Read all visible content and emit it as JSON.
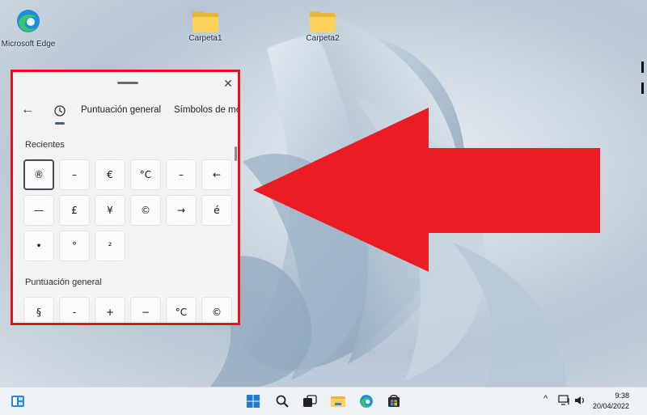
{
  "desktop": {
    "icons": [
      {
        "label": "Microsoft Edge",
        "icon": "edge-icon"
      },
      {
        "label": "Carpeta1",
        "icon": "folder-icon"
      },
      {
        "label": "Carpeta2",
        "icon": "folder-icon"
      }
    ]
  },
  "emoji_panel": {
    "close_glyph": "✕",
    "back_glyph": "←",
    "tabs": [
      "Puntuación general",
      "Símbolos de mo"
    ],
    "sections": {
      "recent_title": "Recientes",
      "punctuation_title": "Puntuación general"
    },
    "recent_symbols": [
      "®",
      "–",
      "€",
      "°C",
      "–",
      "←",
      "—",
      "£",
      "¥",
      "©",
      "→",
      "é",
      "•",
      "°",
      "²"
    ],
    "punctuation_symbols": [
      "§",
      "-",
      "+",
      "−",
      "°C",
      "©"
    ]
  },
  "annotation": {
    "arrow_color": "#ec1c24",
    "frame_color": "#e3121b"
  },
  "taskbar": {
    "clock_time": "9:38",
    "clock_date": "20/04/2022",
    "tray_chevron": "^",
    "icons": [
      "widgets-icon",
      "start-icon",
      "search-icon",
      "task-view-icon",
      "file-explorer-icon",
      "edge-icon",
      "store-icon"
    ]
  }
}
